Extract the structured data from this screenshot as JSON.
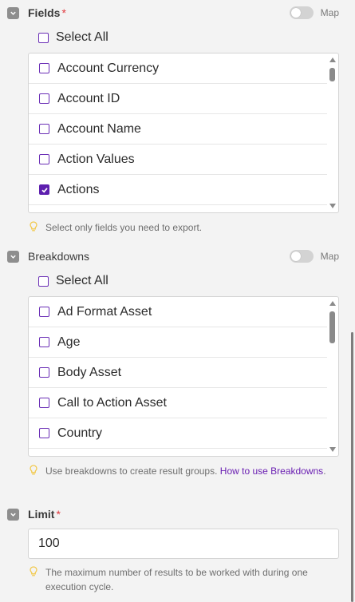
{
  "fields": {
    "title": "Fields",
    "required_mark": "*",
    "map_label": "Map",
    "select_all_label": "Select All",
    "items": [
      {
        "label": "Account Currency",
        "checked": false
      },
      {
        "label": "Account ID",
        "checked": false
      },
      {
        "label": "Account Name",
        "checked": false
      },
      {
        "label": "Action Values",
        "checked": false
      },
      {
        "label": "Actions",
        "checked": true
      }
    ],
    "hint": "Select only fields you need to export."
  },
  "breakdowns": {
    "title": "Breakdowns",
    "map_label": "Map",
    "select_all_label": "Select All",
    "items": [
      {
        "label": "Ad Format Asset",
        "checked": false
      },
      {
        "label": "Age",
        "checked": false
      },
      {
        "label": "Body Asset",
        "checked": false
      },
      {
        "label": "Call to Action Asset",
        "checked": false
      },
      {
        "label": "Country",
        "checked": false
      }
    ],
    "hint_prefix": "Use breakdowns to create result groups. ",
    "hint_link": "How to use Breakdowns",
    "hint_suffix": "."
  },
  "limit": {
    "title": "Limit",
    "required_mark": "*",
    "value": "100",
    "hint": "The maximum number of results to be worked with during one execution cycle."
  },
  "colors": {
    "accent": "#5d1fae",
    "link": "#6a1fb2",
    "required": "#e0383e",
    "hint_icon": "#f2c94c"
  }
}
